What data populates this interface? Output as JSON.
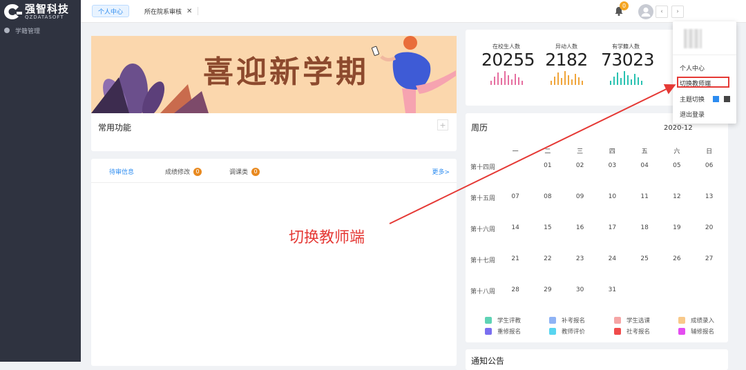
{
  "app": {
    "logo_cn": "强智科技",
    "logo_en": "QZDATASOFT"
  },
  "sidebar": {
    "items": [
      {
        "label": "学籍管理",
        "icon": "settings-icon"
      }
    ]
  },
  "tabs": [
    {
      "label": "个人中心",
      "active": true
    },
    {
      "label": "所在院系审核",
      "active": false,
      "closable": true
    }
  ],
  "header": {
    "badge_count": "0",
    "prev_label": "‹",
    "next_label": "›"
  },
  "banner": {
    "text": "喜迎新学期"
  },
  "quick_links": {
    "title": "常用功能",
    "add_label": "+"
  },
  "tasks": {
    "tabs": [
      {
        "label": "待审信息",
        "active": true
      },
      {
        "label": "成绩修改",
        "count": "0"
      },
      {
        "label": "调课类",
        "count": "0"
      }
    ],
    "more_label": "更多>"
  },
  "stats": [
    {
      "label": "在校生人数",
      "value": "20255",
      "color": "#e66fa0"
    },
    {
      "label": "异动人数",
      "value": "2182",
      "color": "#f0a53b"
    },
    {
      "label": "有学籍人数",
      "value": "73023",
      "color": "#29c2b1"
    }
  ],
  "calendar": {
    "title": "周历",
    "year_month": "2020-12",
    "weekdays": [
      "一",
      "二",
      "三",
      "四",
      "五",
      "六",
      "日"
    ],
    "weeks": [
      {
        "label": "第十四周",
        "days": [
          "",
          "01",
          "02",
          "03",
          "04",
          "05",
          "06"
        ]
      },
      {
        "label": "第十五周",
        "days": [
          "07",
          "08",
          "09",
          "10",
          "11",
          "12",
          "13"
        ]
      },
      {
        "label": "第十六周",
        "days": [
          "14",
          "15",
          "16",
          "17",
          "18",
          "19",
          "20"
        ]
      },
      {
        "label": "第十七周",
        "days": [
          "21",
          "22",
          "23",
          "24",
          "25",
          "26",
          "27"
        ]
      },
      {
        "label": "第十八周",
        "days": [
          "28",
          "29",
          "30",
          "31",
          "",
          "",
          ""
        ]
      }
    ],
    "legend": [
      {
        "label": "学生评教",
        "color": "#5fd3b5"
      },
      {
        "label": "补考报名",
        "color": "#8fb3f5"
      },
      {
        "label": "学生选课",
        "color": "#f5a5a5"
      },
      {
        "label": "成绩录入",
        "color": "#f8c98a"
      },
      {
        "label": "重修报名",
        "color": "#7a6ff0"
      },
      {
        "label": "教师评价",
        "color": "#58d5f0"
      },
      {
        "label": "社考报名",
        "color": "#f04b4b"
      },
      {
        "label": "辅修报名",
        "color": "#e44df0"
      }
    ]
  },
  "notice": {
    "title": "通知公告"
  },
  "user_menu": {
    "items": [
      "个人中心",
      "切换教师端",
      "主题切换",
      "退出登录"
    ],
    "theme_colors": [
      "#2d8cf0",
      "#444444"
    ]
  },
  "annotation": {
    "text": "切换教师端",
    "color": "#e53935"
  }
}
